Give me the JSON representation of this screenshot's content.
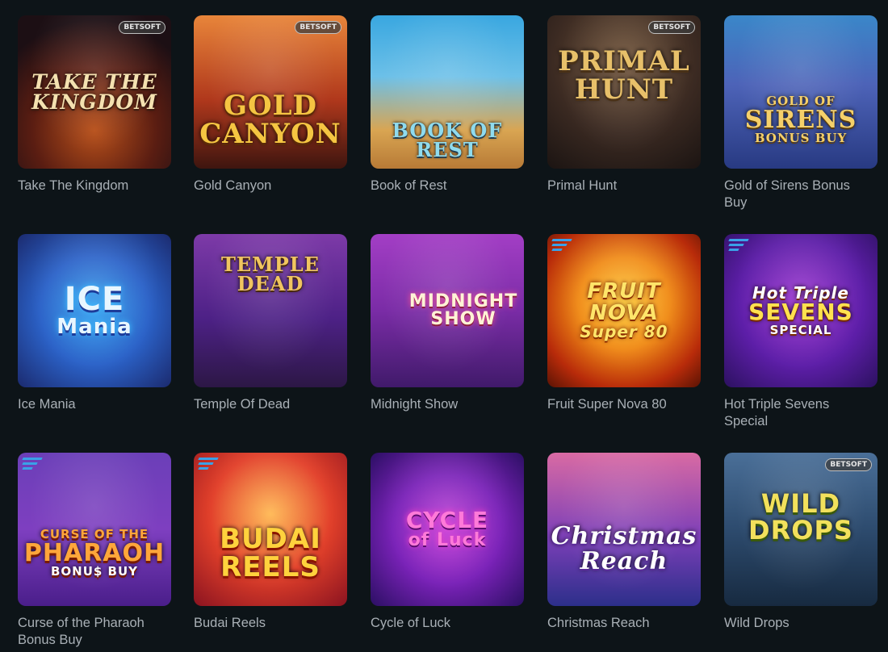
{
  "games": [
    {
      "title": "Take The Kingdom",
      "logo": [
        "Take The",
        "Kingdom",
        ""
      ],
      "provider": "BETSOFT",
      "badge": ""
    },
    {
      "title": "Gold Canyon",
      "logo": [
        "Gold",
        "Canyon",
        ""
      ],
      "provider": "BETSOFT",
      "badge": ""
    },
    {
      "title": "Book of Rest",
      "logo": [
        "Book of Rest",
        "",
        ""
      ],
      "provider": "",
      "badge": ""
    },
    {
      "title": "Primal Hunt",
      "logo": [
        "Primal",
        "Hunt",
        ""
      ],
      "provider": "BETSOFT",
      "badge": ""
    },
    {
      "title": "Gold of Sirens Bonus Buy",
      "logo": [
        "Gold of",
        "Sirens",
        "Bonus Buy"
      ],
      "provider": "",
      "badge": ""
    },
    {
      "title": "Ice Mania",
      "logo": [
        "Ice",
        "Mania",
        ""
      ],
      "provider": "",
      "badge": ""
    },
    {
      "title": "Temple Of Dead",
      "logo": [
        "Temple",
        "Dead",
        ""
      ],
      "provider": "",
      "badge": ""
    },
    {
      "title": "Midnight Show",
      "logo": [
        "Midnight",
        "Show",
        ""
      ],
      "provider": "",
      "badge": ""
    },
    {
      "title": "Fruit Super Nova 80",
      "logo": [
        "Fruit Nova",
        "Super 80",
        ""
      ],
      "provider": "",
      "badge": "stripes"
    },
    {
      "title": "Hot Triple Sevens Special",
      "logo": [
        "Hot Triple",
        "Sevens",
        "Special"
      ],
      "provider": "",
      "badge": "stripes"
    },
    {
      "title": "Curse of the Pharaoh Bonus Buy",
      "logo": [
        "Curse of the",
        "Pharaoh",
        "Bonu$ Buy"
      ],
      "provider": "",
      "badge": "stripes"
    },
    {
      "title": "Budai Reels",
      "logo": [
        "Budai",
        "Reels",
        ""
      ],
      "provider": "",
      "badge": "stripes"
    },
    {
      "title": "Cycle of Luck",
      "logo": [
        "Cycle",
        "of Luck",
        ""
      ],
      "provider": "",
      "badge": ""
    },
    {
      "title": "Christmas Reach",
      "logo": [
        "Christmas",
        "Reach",
        ""
      ],
      "provider": "",
      "badge": ""
    },
    {
      "title": "Wild Drops",
      "logo": [
        "Wild",
        "Drops",
        ""
      ],
      "provider": "BETSOFT",
      "badge": ""
    }
  ]
}
